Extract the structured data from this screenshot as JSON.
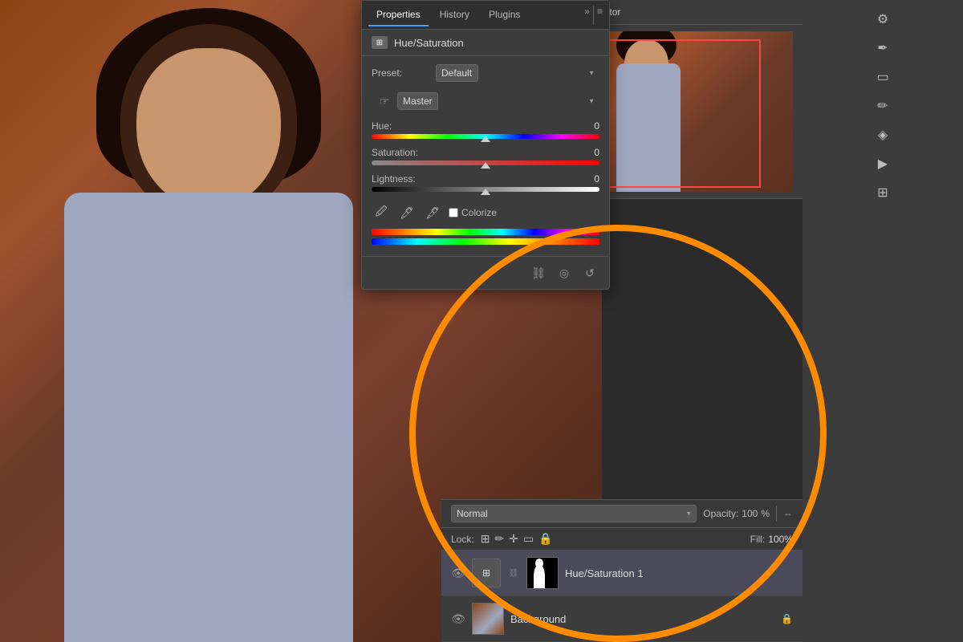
{
  "canvas": {
    "bg_description": "Rusty brown textured background with woman in purple hoodie"
  },
  "properties_panel": {
    "tabs": [
      {
        "label": "Properties",
        "active": true
      },
      {
        "label": "History",
        "active": false
      },
      {
        "label": "Plugins",
        "active": false
      }
    ],
    "header_icon": "⊞",
    "title": "Hue/Saturation",
    "preset_label": "Preset:",
    "preset_value": "Default",
    "channel_value": "Master",
    "hue_label": "Hue:",
    "hue_value": "0",
    "hue_position": "50%",
    "saturation_label": "Saturation:",
    "saturation_value": "0",
    "saturation_position": "50%",
    "lightness_label": "Lightness:",
    "lightness_value": "0",
    "lightness_position": "50%",
    "colorize_label": "Colorize",
    "footer_icons": [
      "link-icon",
      "eye-icon",
      "undo-icon"
    ]
  },
  "navigator_panel": {
    "tab_label": "Navigator"
  },
  "layers_panel": {
    "blend_mode": "Normal",
    "opacity_label": "Opacity:",
    "opacity_value": "100",
    "opacity_unit": "%",
    "lock_label": "Lock:",
    "fill_label": "Fill:",
    "fill_value": "100%",
    "layers": [
      {
        "name": "Hue/Saturation 1",
        "visible": true,
        "type": "adjustment"
      },
      {
        "name": "Background",
        "visible": true,
        "type": "image"
      }
    ]
  },
  "toolbar": {
    "icons": [
      {
        "name": "sliders-icon",
        "symbol": "⚙"
      },
      {
        "name": "pen-icon",
        "symbol": "✒"
      },
      {
        "name": "rectangle-icon",
        "symbol": "⬜"
      },
      {
        "name": "brush-icon",
        "symbol": "✏"
      },
      {
        "name": "palette-icon",
        "symbol": "🎨"
      },
      {
        "name": "play-icon",
        "symbol": "▶"
      },
      {
        "name": "layers-icon",
        "symbol": "⊞"
      }
    ]
  },
  "colors": {
    "panel_bg": "#3C3C3C",
    "panel_dark": "#2F2F2F",
    "accent_blue": "#4A9EFF",
    "text_light": "#DDDDDD",
    "text_muted": "#BBBBBB",
    "orange_circle": "#FF8C00",
    "border": "#555555"
  }
}
